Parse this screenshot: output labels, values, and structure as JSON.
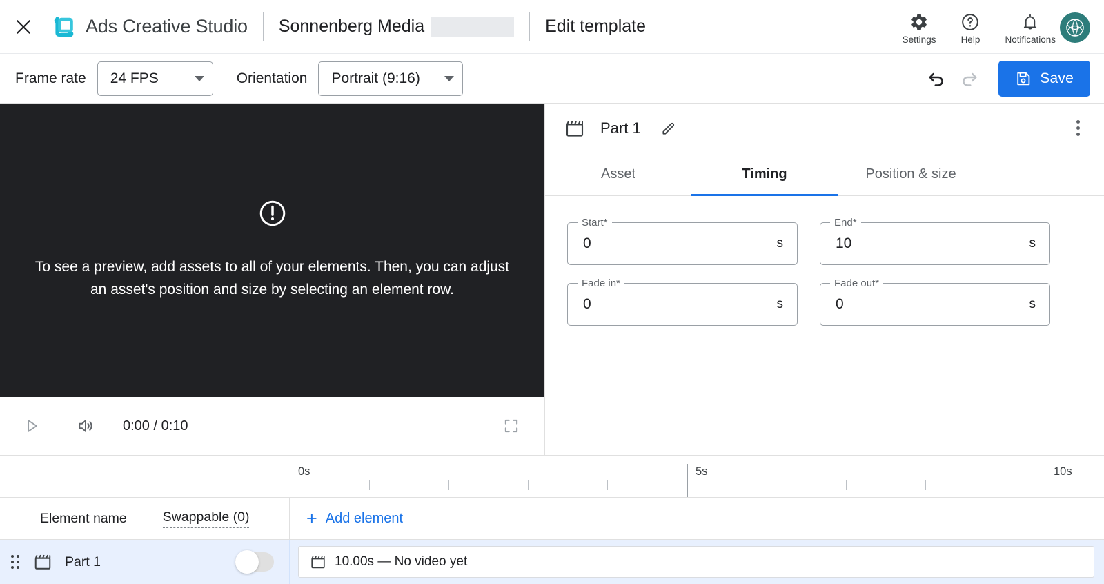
{
  "header": {
    "close_icon": "close-icon",
    "logo_icon": "ads-creative-studio-logo",
    "brand_title": "Ads Creative Studio",
    "account_name": "Sonnenberg Media",
    "page_title": "Edit template",
    "actions": [
      {
        "label": "Settings",
        "icon": "gear-icon"
      },
      {
        "label": "Help",
        "icon": "help-circle-icon"
      },
      {
        "label": "Notifications",
        "icon": "bell-icon"
      }
    ],
    "avatar_icon": "avatar",
    "avatar_color": "#2e7d7b",
    "logo_color": "#1fbcd2"
  },
  "toolbar": {
    "frame_rate_label": "Frame rate",
    "frame_rate_value": "24 FPS",
    "orientation_label": "Orientation",
    "orientation_value": "Portrait (9:16)",
    "undo_icon": "undo-icon",
    "redo_icon": "redo-icon",
    "save_label": "Save",
    "save_icon": "save-disk-icon",
    "accent_color": "#1a73e8"
  },
  "preview": {
    "warning_icon": "exclamation-circle-icon",
    "message": "To see a preview, add assets to all of your elements. Then, you can adjust an asset's position and size by selecting an element row.",
    "background_color": "#202124"
  },
  "player": {
    "play_icon": "play-icon",
    "volume_icon": "volume-icon",
    "time": "0:00 / 0:10",
    "fullscreen_icon": "fullscreen-icon"
  },
  "panel": {
    "part_icon": "clapperboard-icon",
    "title": "Part 1",
    "edit_icon": "pencil-icon",
    "more_icon": "kebab-menu-icon",
    "tabs": [
      {
        "label": "Asset",
        "active": false
      },
      {
        "label": "Timing",
        "active": true
      },
      {
        "label": "Position & size",
        "active": false
      }
    ],
    "fields": [
      {
        "label": "Start*",
        "value": "0",
        "unit": "s"
      },
      {
        "label": "End*",
        "value": "10",
        "unit": "s"
      },
      {
        "label": "Fade in*",
        "value": "0",
        "unit": "s"
      },
      {
        "label": "Fade out*",
        "value": "0",
        "unit": "s"
      }
    ]
  },
  "timeline": {
    "ruler_labels": [
      "0s",
      "5s",
      "10s"
    ],
    "columns": {
      "element_name": "Element name",
      "swappable": "Swappable (0)"
    },
    "add_element_label": "Add element",
    "add_element_icon": "plus-icon",
    "rows": [
      {
        "drag_icon": "drag-handle-icon",
        "type_icon": "clapperboard-icon",
        "name": "Part 1",
        "swappable": false,
        "clip_icon": "clapperboard-icon",
        "clip_label": "10.00s — No video yet"
      }
    ]
  }
}
